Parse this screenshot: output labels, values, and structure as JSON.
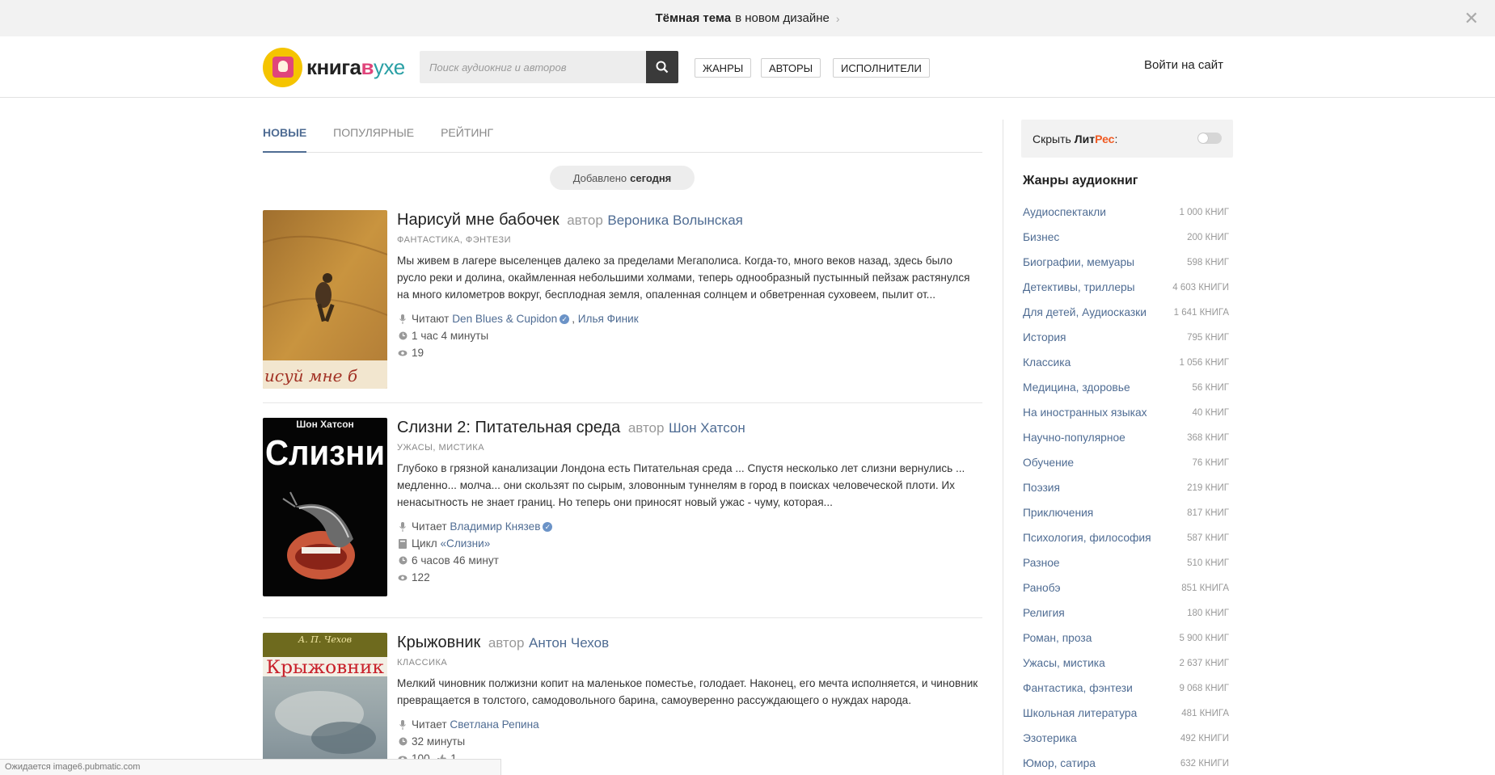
{
  "banner": {
    "bold": "Тёмная тема",
    "rest": "в новом дизайне",
    "chevron": "›",
    "close": "✕"
  },
  "header": {
    "logo": {
      "part1": "книга",
      "part2": "в",
      "part3": "ухе"
    },
    "search_placeholder": "Поиск аудиокниг и авторов",
    "nav": [
      "ЖАНРЫ",
      "АВТОРЫ",
      "ИСПОЛНИТЕЛИ"
    ],
    "login": "Войти на сайт"
  },
  "tabs": [
    "НОВЫЕ",
    "ПОПУЛЯРНЫЕ",
    "РЕЙТИНГ"
  ],
  "added": {
    "prefix": "Добавлено",
    "when": "сегодня"
  },
  "books": [
    {
      "title": "Нарисуй мне бабочек",
      "by": "автор",
      "author": "Вероника Волынская",
      "genres": "ФАНТАСТИКА, ФЭНТЕЗИ",
      "description": "Мы живем в лагере выселенцев далеко за пределами Мегаполиса. Когда-то, много веков назад, здесь было русло реки и долина, окаймленная небольшими холмами, теперь однообразный пустынный пейзаж растянулся на много километров вокруг, бесплодная земля, опаленная солнцем и обветренная суховеем, пылит от...",
      "read_label": "Читают",
      "readers": [
        "Den Blues & Cupidon",
        "Илья Финик"
      ],
      "reader_sep": ",",
      "duration": "1 час 4 минуты",
      "views": "19",
      "cover_text": "исуй мне б"
    },
    {
      "title": "Слизни 2: Питательная среда",
      "by": "автор",
      "author": "Шон Хатсон",
      "genres": "УЖАСЫ, МИСТИКА",
      "description": "Глубоко в грязной канализации Лондона есть Питательная среда ... Спустя несколько лет слизни вернулись ... медленно... молча... они скользят по сырым, зловонным туннелям в город в поисках человеческой плоти. Их ненасытность не знает границ. Но теперь они приносят новый ужас - чуму, которая...",
      "read_label": "Читает",
      "readers": [
        "Владимир Князев"
      ],
      "cycle_label": "Цикл",
      "cycle": "«Слизни»",
      "duration": "6 часов 46 минут",
      "views": "122",
      "cover_author": "Шон Хатсон",
      "cover_title": "Слизни"
    },
    {
      "title": "Крыжовник",
      "by": "автор",
      "author": "Антон Чехов",
      "genres": "КЛАССИКА",
      "description": "Мелкий чиновник полжизни копит на маленькое поместье, голодает. Наконец, его мечта исполняется, и чиновник превращается в толстого, самодовольного барина, самоуверенно рассуждающего о нуждах народа.",
      "read_label": "Читает",
      "readers": [
        "Светлана Репина"
      ],
      "duration": "32 минуты",
      "views": "100",
      "likes": "1",
      "cover_author": "А. П. Чехов",
      "cover_title": "Крыжовник"
    }
  ],
  "sidebar": {
    "litres": {
      "prefix": "Скрыть",
      "lit": "Лит",
      "res": "Рес",
      "colon": ":"
    },
    "genres_title": "Жанры аудиокниг",
    "genres": [
      {
        "name": "Аудиоспектакли",
        "count": "1 000 книг"
      },
      {
        "name": "Бизнес",
        "count": "200 книг"
      },
      {
        "name": "Биографии, мемуары",
        "count": "598 книг"
      },
      {
        "name": "Детективы, триллеры",
        "count": "4 603 книги"
      },
      {
        "name": "Для детей, Аудиосказки",
        "count": "1 641 книга"
      },
      {
        "name": "История",
        "count": "795 книг"
      },
      {
        "name": "Классика",
        "count": "1 056 книг"
      },
      {
        "name": "Медицина, здоровье",
        "count": "56 книг"
      },
      {
        "name": "На иностранных языках",
        "count": "40 книг"
      },
      {
        "name": "Научно-популярное",
        "count": "368 книг"
      },
      {
        "name": "Обучение",
        "count": "76 книг"
      },
      {
        "name": "Поэзия",
        "count": "219 книг"
      },
      {
        "name": "Приключения",
        "count": "817 книг"
      },
      {
        "name": "Психология, философия",
        "count": "587 книг"
      },
      {
        "name": "Разное",
        "count": "510 книг"
      },
      {
        "name": "Ранобэ",
        "count": "851 книга"
      },
      {
        "name": "Религия",
        "count": "180 книг"
      },
      {
        "name": "Роман, проза",
        "count": "5 900 книг"
      },
      {
        "name": "Ужасы, мистика",
        "count": "2 637 книг"
      },
      {
        "name": "Фантастика, фэнтези",
        "count": "9 068 книг"
      },
      {
        "name": "Школьная литература",
        "count": "481 книга"
      },
      {
        "name": "Эзотерика",
        "count": "492 книги"
      },
      {
        "name": "Юмор, сатира",
        "count": "632 книги"
      }
    ]
  },
  "status_bar": "Ожидается image6.pubmatic.com",
  "colors": {
    "accent": "#4f6c93",
    "logo_yellow": "#f5c400",
    "logo_pink": "#e0457b",
    "logo_teal": "#2aa0a5",
    "litres_orange": "#f05a22"
  },
  "icons": {
    "search": "search-icon",
    "mic": "microphone-icon",
    "clock": "clock-icon",
    "eye": "eye-icon",
    "book": "book-icon",
    "thumb": "thumb-up-icon",
    "verified": "verified-icon"
  }
}
